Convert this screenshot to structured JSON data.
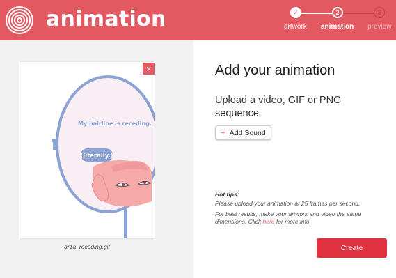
{
  "header": {
    "title": "animation",
    "steps": [
      {
        "label": "artwork",
        "symbol": "✓",
        "state": "done"
      },
      {
        "label": "animation",
        "symbol": "2",
        "state": "active"
      },
      {
        "label": "preview",
        "symbol": "3",
        "state": "pending"
      }
    ]
  },
  "preview": {
    "close_label": "×",
    "filename": "ar1a_receding.gif",
    "caption": "My hairline is receding.",
    "bubble": "(literally.)"
  },
  "main": {
    "heading": "Add your animation",
    "subtext": "Upload a video, GIF or PNG sequence.",
    "add_sound_label": "Add Sound",
    "tips_title": "Hot tips:",
    "tip1": "Please upload your animation at 25 frames per second.",
    "tip2_prefix": "For best results, make your artwork and video the same dimensions. Click ",
    "tip2_link": "here",
    "tip2_suffix": " for more info.",
    "create_label": "Create"
  },
  "colors": {
    "brand": "#e25962",
    "create": "#e0313f"
  }
}
